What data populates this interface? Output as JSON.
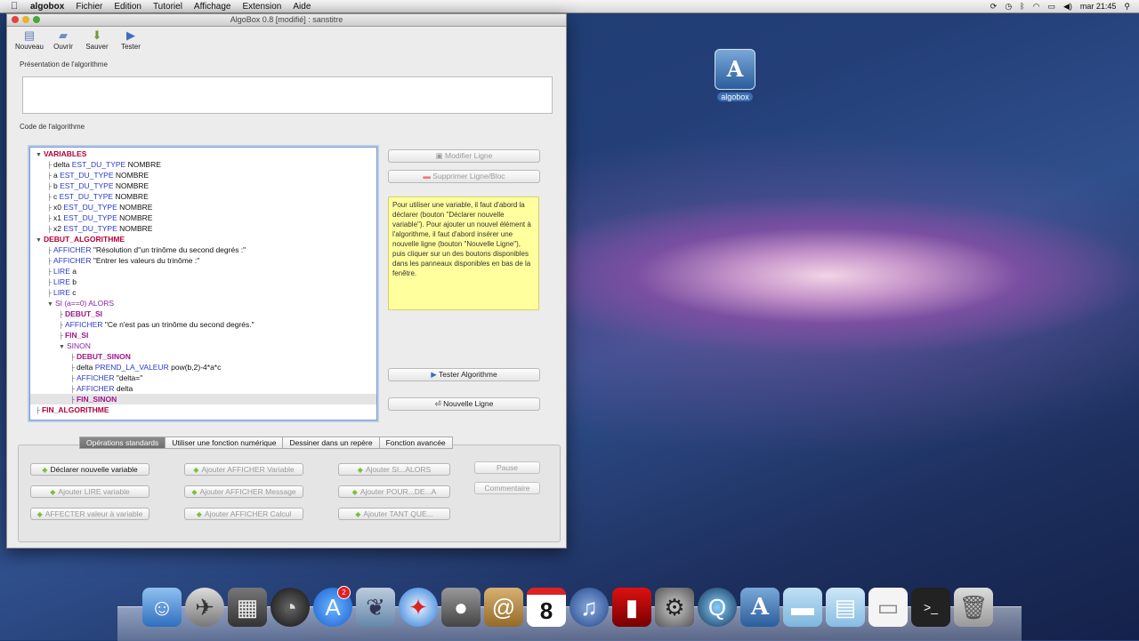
{
  "menubar": {
    "apple": "",
    "app_name": "algobox",
    "items": [
      "Fichier",
      "Edition",
      "Tutoriel",
      "Affichage",
      "Extension",
      "Aide"
    ],
    "clock": "mar 21:45"
  },
  "desktop": {
    "icon_label": "algobox",
    "icon_glyph": "A"
  },
  "window": {
    "title": "AlgoBox 0.8 [modifié] : sanstitre",
    "toolbar": [
      "Nouveau",
      "Ouvrir",
      "Sauver",
      "Tester"
    ],
    "presentation_label": "Présentation de l'algorithme",
    "code_label": "Code de l'algorithme"
  },
  "tree": [
    {
      "indent": 0,
      "parts": [
        {
          "t": "VARIABLES",
          "c": "kw-red"
        }
      ],
      "tri": true
    },
    {
      "indent": 1,
      "parts": [
        {
          "t": "delta ",
          "c": ""
        },
        {
          "t": "EST_DU_TYPE",
          "c": "kw-blue"
        },
        {
          "t": " NOMBRE",
          "c": ""
        }
      ]
    },
    {
      "indent": 1,
      "parts": [
        {
          "t": "a ",
          "c": ""
        },
        {
          "t": "EST_DU_TYPE",
          "c": "kw-blue"
        },
        {
          "t": " NOMBRE",
          "c": ""
        }
      ]
    },
    {
      "indent": 1,
      "parts": [
        {
          "t": "b ",
          "c": ""
        },
        {
          "t": "EST_DU_TYPE",
          "c": "kw-blue"
        },
        {
          "t": " NOMBRE",
          "c": ""
        }
      ]
    },
    {
      "indent": 1,
      "parts": [
        {
          "t": "c ",
          "c": ""
        },
        {
          "t": "EST_DU_TYPE",
          "c": "kw-blue"
        },
        {
          "t": " NOMBRE",
          "c": ""
        }
      ]
    },
    {
      "indent": 1,
      "parts": [
        {
          "t": "x0 ",
          "c": ""
        },
        {
          "t": "EST_DU_TYPE",
          "c": "kw-blue"
        },
        {
          "t": " NOMBRE",
          "c": ""
        }
      ]
    },
    {
      "indent": 1,
      "parts": [
        {
          "t": "x1 ",
          "c": ""
        },
        {
          "t": "EST_DU_TYPE",
          "c": "kw-blue"
        },
        {
          "t": " NOMBRE",
          "c": ""
        }
      ]
    },
    {
      "indent": 1,
      "parts": [
        {
          "t": "x2 ",
          "c": ""
        },
        {
          "t": "EST_DU_TYPE",
          "c": "kw-blue"
        },
        {
          "t": " NOMBRE",
          "c": ""
        }
      ]
    },
    {
      "indent": 0,
      "parts": [
        {
          "t": "DEBUT_ALGORITHME",
          "c": "kw-red"
        }
      ],
      "tri": true
    },
    {
      "indent": 1,
      "parts": [
        {
          "t": "AFFICHER",
          "c": "kw-blue"
        },
        {
          "t": " \"Résolution d''un trinôme du second degrés :\"",
          "c": ""
        }
      ]
    },
    {
      "indent": 1,
      "parts": [
        {
          "t": "AFFICHER",
          "c": "kw-blue"
        },
        {
          "t": " \"Entrer les valeurs du trinôme :\"",
          "c": ""
        }
      ]
    },
    {
      "indent": 1,
      "parts": [
        {
          "t": "LIRE",
          "c": "kw-blue"
        },
        {
          "t": " a",
          "c": ""
        }
      ]
    },
    {
      "indent": 1,
      "parts": [
        {
          "t": "LIRE",
          "c": "kw-blue"
        },
        {
          "t": " b",
          "c": ""
        }
      ]
    },
    {
      "indent": 1,
      "parts": [
        {
          "t": "LIRE",
          "c": "kw-blue"
        },
        {
          "t": " c",
          "c": ""
        }
      ]
    },
    {
      "indent": 1,
      "parts": [
        {
          "t": "SI (a==0) ALORS",
          "c": "kw-purple"
        }
      ],
      "tri": true
    },
    {
      "indent": 2,
      "parts": [
        {
          "t": "DEBUT_SI",
          "c": "kw-magenta"
        }
      ]
    },
    {
      "indent": 2,
      "parts": [
        {
          "t": "AFFICHER",
          "c": "kw-blue"
        },
        {
          "t": " \"Ce n'est pas un trinôme du second degrés.\"",
          "c": ""
        }
      ]
    },
    {
      "indent": 2,
      "parts": [
        {
          "t": "FIN_SI",
          "c": "kw-magenta"
        }
      ]
    },
    {
      "indent": 2,
      "parts": [
        {
          "t": "SINON",
          "c": "kw-purple"
        }
      ],
      "tri": true
    },
    {
      "indent": 3,
      "parts": [
        {
          "t": "DEBUT_SINON",
          "c": "kw-magenta"
        }
      ]
    },
    {
      "indent": 3,
      "parts": [
        {
          "t": "delta ",
          "c": ""
        },
        {
          "t": "PREND_LA_VALEUR",
          "c": "kw-blue"
        },
        {
          "t": " pow(b,2)-4*a*c",
          "c": ""
        }
      ]
    },
    {
      "indent": 3,
      "parts": [
        {
          "t": "AFFICHER",
          "c": "kw-blue"
        },
        {
          "t": " \"delta=\"",
          "c": ""
        }
      ]
    },
    {
      "indent": 3,
      "parts": [
        {
          "t": "AFFICHER",
          "c": "kw-blue"
        },
        {
          "t": " delta",
          "c": ""
        }
      ]
    },
    {
      "indent": 3,
      "parts": [
        {
          "t": "FIN_SINON",
          "c": "kw-magenta"
        }
      ],
      "selected": true
    },
    {
      "indent": 0,
      "parts": [
        {
          "t": "FIN_ALGORITHME",
          "c": "kw-red"
        }
      ]
    }
  ],
  "side_buttons": {
    "modifier": "Modifier Ligne",
    "supprimer": "Supprimer Ligne/Bloc",
    "tester": "Tester Algorithme",
    "nouvelle": "Nouvelle Ligne"
  },
  "note_text": "Pour utiliser une variable, il faut d'abord la déclarer (bouton \"Déclarer nouvelle variable\"). Pour ajouter un nouvel élément à l'algorithme, il faut d'abord insérer une nouvelle ligne (bouton \"Nouvelle Ligne\"), puis cliquer sur un des boutons disponibles dans les panneaux disponibles en bas de la fenêtre.",
  "tabs": [
    "Opérations standards",
    "Utiliser une fonction numérique",
    "Dessiner dans un repère",
    "Fonction avancée"
  ],
  "ops": {
    "declarer": "Déclarer nouvelle variable",
    "lire": "Ajouter LIRE variable",
    "affecter": "AFFECTER valeur à variable",
    "aff_var": "Ajouter AFFICHER Variable",
    "aff_msg": "Ajouter AFFICHER Message",
    "aff_calc": "Ajouter AFFICHER Calcul",
    "si": "Ajouter SI...ALORS",
    "pour": "Ajouter POUR...DE...A",
    "tant": "Ajouter TANT QUE...",
    "pause": "Pause",
    "comment": "Commentaire"
  },
  "dock": {
    "badge_count": "2",
    "calendar_day": "8",
    "items": [
      "finder-icon",
      "launchpad-icon",
      "photo-booth-icon",
      "dashboard-icon",
      "app-store-icon",
      "preview-icon",
      "safari-icon",
      "facetime-icon",
      "contacts-icon",
      "calendar-icon",
      "itunes-icon",
      "photo-booth-red-icon",
      "system-preferences-icon",
      "quicktime-icon",
      "algobox-icon",
      "folder-icon",
      "downloads-icon",
      "document-icon",
      "terminal-icon",
      "trash-icon"
    ]
  }
}
